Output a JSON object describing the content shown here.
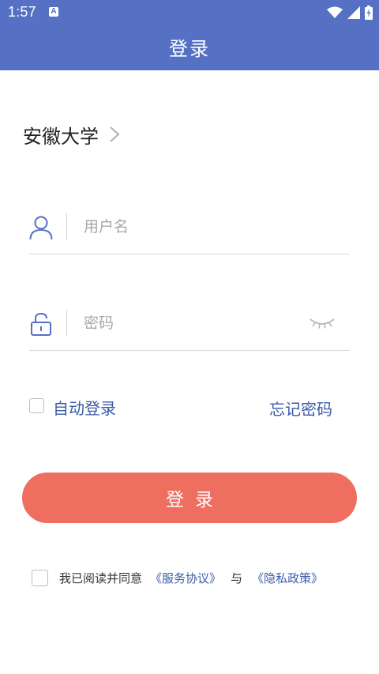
{
  "status_bar": {
    "time": "1:57",
    "notification_icon_letter": "A"
  },
  "header": {
    "title": "登录",
    "bg_color": "#5670C4"
  },
  "school": {
    "name": "安徽大学"
  },
  "username_field": {
    "placeholder": "用户名",
    "value": ""
  },
  "password_field": {
    "placeholder": "密码",
    "value": ""
  },
  "options": {
    "auto_login_label": "自动登录",
    "forgot_password_label": "忘记密码"
  },
  "login_button": {
    "label": "登录",
    "color": "#EE6E5F"
  },
  "agreement": {
    "prefix": "我已阅读并同意",
    "service_link": "《服务协议》",
    "and": "与",
    "privacy_link": "《隐私政策》"
  },
  "colors": {
    "accent_blue": "#3B5BA8",
    "icon_blue": "#5670C4"
  }
}
